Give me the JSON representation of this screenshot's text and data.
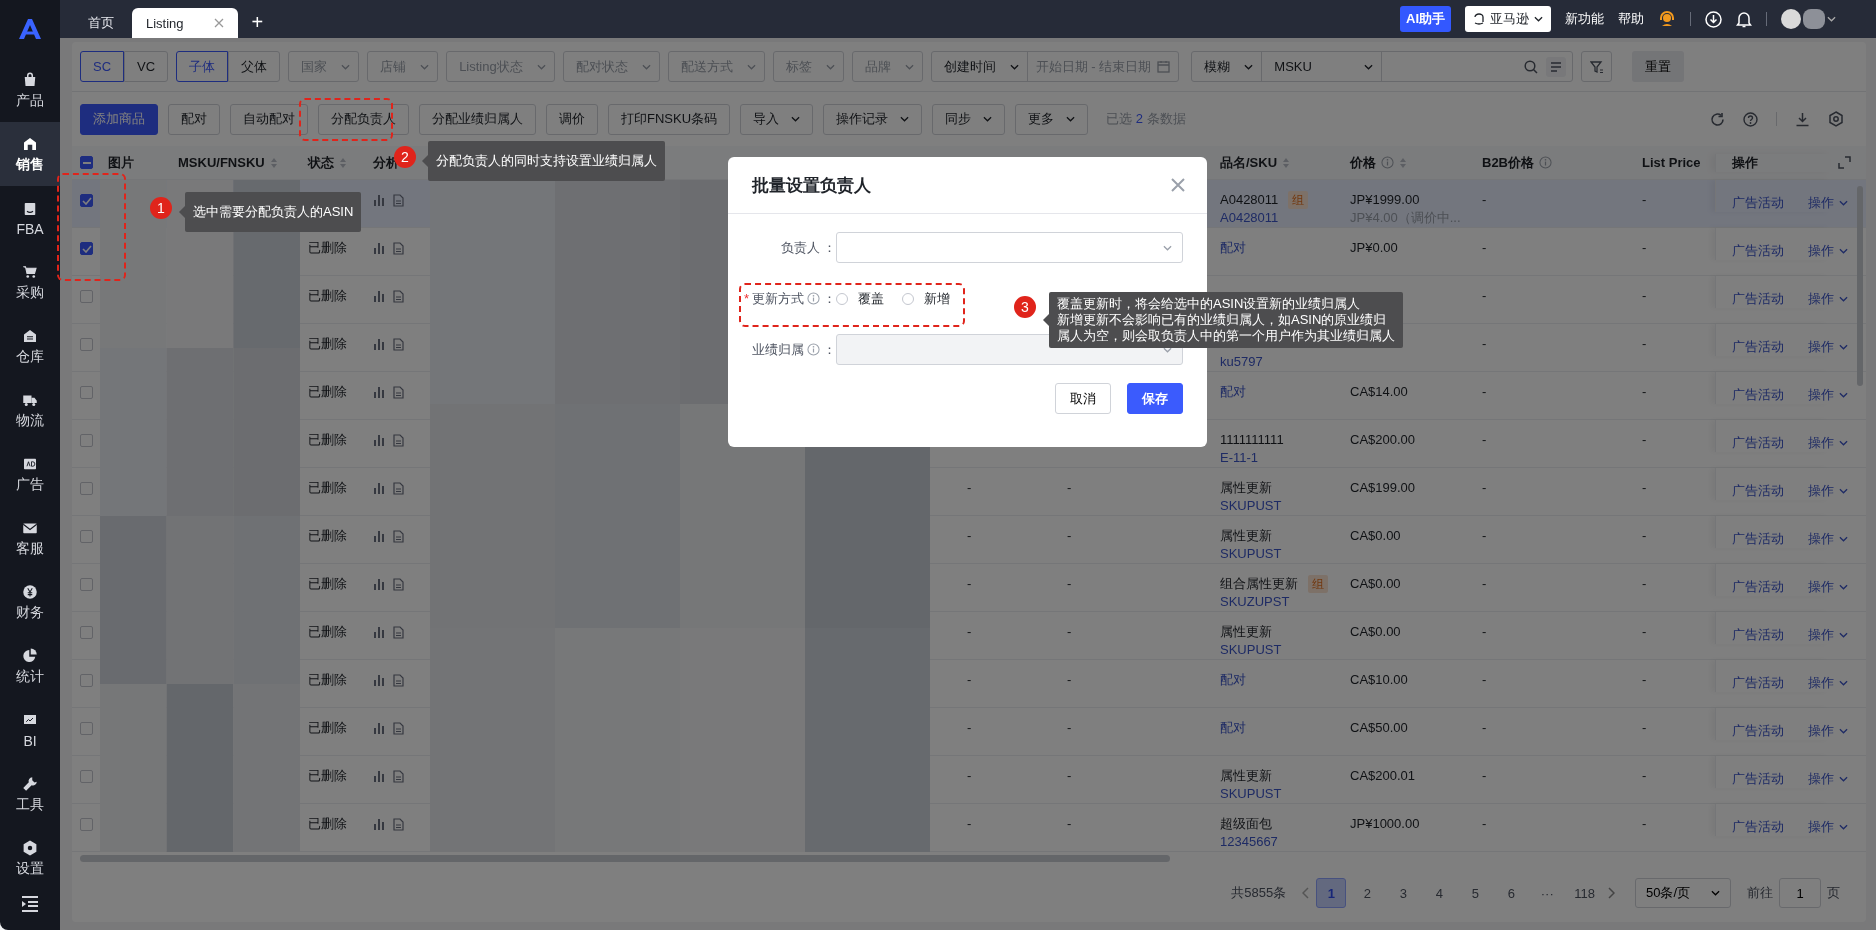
{
  "topbar": {
    "tabs": [
      {
        "label": "首页",
        "selected": false,
        "closable": false
      },
      {
        "label": "Listing",
        "selected": true,
        "closable": true
      }
    ],
    "add_tab": "+",
    "ai_button": "AI助手",
    "platform": "亚马逊",
    "links": [
      "新功能",
      "帮助"
    ]
  },
  "sidebar": {
    "items": [
      {
        "label": "产品",
        "selected": false
      },
      {
        "label": "销售",
        "selected": true
      },
      {
        "label": "FBA",
        "selected": false
      },
      {
        "label": "采购",
        "selected": false
      },
      {
        "label": "仓库",
        "selected": false
      },
      {
        "label": "物流",
        "selected": false
      },
      {
        "label": "广告",
        "selected": false
      },
      {
        "label": "客服",
        "selected": false
      },
      {
        "label": "财务",
        "selected": false
      },
      {
        "label": "统计",
        "selected": false
      },
      {
        "label": "BI",
        "selected": false
      },
      {
        "label": "工具",
        "selected": false
      },
      {
        "label": "设置",
        "selected": false
      }
    ]
  },
  "filters": {
    "segments": [
      [
        {
          "label": "SC",
          "selected": true
        },
        {
          "label": "VC",
          "selected": false
        }
      ],
      [
        {
          "label": "子体",
          "selected": true
        },
        {
          "label": "父体",
          "selected": false
        }
      ]
    ],
    "dropdowns": [
      "国家",
      "店铺",
      "Listing状态",
      "配对状态",
      "配送方式",
      "标签",
      "品牌"
    ],
    "date": {
      "field": "创建时间",
      "start_placeholder": "开始日期",
      "separator": "-",
      "end_placeholder": "结束日期"
    },
    "search": {
      "mode": "模糊",
      "field": "MSKU"
    },
    "reset": "重置"
  },
  "actions": {
    "buttons": [
      {
        "label": "添加商品",
        "kind": "primary"
      },
      {
        "label": "配对",
        "kind": "plain"
      },
      {
        "label": "自动配对",
        "kind": "plain"
      },
      {
        "label": "分配负责人",
        "kind": "plain"
      },
      {
        "label": "分配业绩归属人",
        "kind": "plain"
      },
      {
        "label": "调价",
        "kind": "plain"
      },
      {
        "label": "打印FNSKU条码",
        "kind": "plain"
      },
      {
        "label": "导入",
        "kind": "dropdown"
      },
      {
        "label": "操作记录",
        "kind": "dropdown"
      },
      {
        "label": "同步",
        "kind": "dropdown"
      },
      {
        "label": "更多",
        "kind": "dropdown"
      }
    ],
    "selection": {
      "prefix": "已选",
      "count": "2",
      "suffix": "条数据"
    }
  },
  "table": {
    "header_checkbox": {
      "indeterminate": true
    },
    "columns": [
      {
        "label": "图片",
        "sortable": false,
        "info": false
      },
      {
        "label": "MSKU/FNSKU",
        "sortable": true,
        "info": false
      },
      {
        "label": "状态",
        "sortable": true,
        "info": false
      },
      {
        "label": "分析"
      },
      {
        "label": "品名/SKU",
        "sortable": true,
        "info": false
      },
      {
        "label": "价格",
        "sortable": true,
        "info": true
      },
      {
        "label": "B2B价格",
        "sortable": false,
        "info": true
      },
      {
        "label": "List Price",
        "sortable": false,
        "info": false
      },
      {
        "label": "操作",
        "sortable": false,
        "info": false
      }
    ],
    "rows": [
      {
        "checked": true,
        "highlighted": true,
        "name": "A0428011",
        "name_tag": "组",
        "sku": "A0428011",
        "price": "JP¥1999.00",
        "price_note": "JP¥4.00（调价中...",
        "b2b": "-",
        "list_price": "-",
        "ad_link": "广告活动",
        "menu": "操作"
      },
      {
        "checked": true,
        "highlighted": false,
        "status": "已删除",
        "link": "配对",
        "price": "JP¥0.00",
        "b2b": "-",
        "list_price": "-",
        "ad_link": "广告活动",
        "menu": "操作"
      },
      {
        "checked": false,
        "highlighted": false,
        "status": "已删除",
        "b2b": "-",
        "list_price": "-",
        "ad_link": "广告活动",
        "menu": "操作"
      },
      {
        "checked": false,
        "highlighted": false,
        "status": "已删除",
        "sku": "ku5797",
        "b2b": "-",
        "list_price": "-",
        "ad_link": "广告活动",
        "menu": "操作"
      },
      {
        "checked": false,
        "highlighted": false,
        "status": "已删除",
        "link": "配对",
        "price": "CA$14.00",
        "b2b": "-",
        "list_price": "-",
        "ad_link": "广告活动",
        "menu": "操作"
      },
      {
        "checked": false,
        "highlighted": false,
        "status": "已删除",
        "name": "1111111111",
        "sku": "E-11-1",
        "price": "CA$200.00",
        "b2b": "-",
        "list_price": "-",
        "ad_link": "广告活动",
        "menu": "操作"
      },
      {
        "checked": false,
        "highlighted": false,
        "status": "已删除",
        "column_6": "-",
        "column_7": "-",
        "name": "属性更新",
        "sku": "SKUPUST",
        "price": "CA$199.00",
        "b2b": "-",
        "list_price": "-",
        "ad_link": "广告活动",
        "menu": "操作"
      },
      {
        "checked": false,
        "highlighted": false,
        "status": "已删除",
        "column_6": "-",
        "column_7": "-",
        "name": "属性更新",
        "sku": "SKUPUST",
        "price": "CA$0.00",
        "b2b": "-",
        "list_price": "-",
        "ad_link": "广告活动",
        "menu": "操作"
      },
      {
        "checked": false,
        "highlighted": false,
        "status": "已删除",
        "column_6": "-",
        "column_7": "-",
        "name": "组合属性更新",
        "name_tag": "组",
        "sku": "SKUZUPST",
        "price": "CA$0.00",
        "b2b": "-",
        "list_price": "-",
        "ad_link": "广告活动",
        "menu": "操作"
      },
      {
        "checked": false,
        "highlighted": false,
        "status": "已删除",
        "column_6": "-",
        "column_7": "-",
        "name": "属性更新",
        "sku": "SKUPUST",
        "price": "CA$0.00",
        "b2b": "-",
        "list_price": "-",
        "ad_link": "广告活动",
        "menu": "操作"
      },
      {
        "checked": false,
        "highlighted": false,
        "status": "已删除",
        "column_6": "-",
        "column_7": "-",
        "link": "配对",
        "price": "CA$10.00",
        "b2b": "-",
        "list_price": "-",
        "ad_link": "广告活动",
        "menu": "操作"
      },
      {
        "checked": false,
        "highlighted": false,
        "status": "已删除",
        "column_6": "-",
        "column_7": "-",
        "link": "配对",
        "price": "CA$50.00",
        "b2b": "-",
        "list_price": "-",
        "ad_link": "广告活动",
        "menu": "操作"
      },
      {
        "checked": false,
        "highlighted": false,
        "status": "已删除",
        "column_6": "-",
        "column_7": "-",
        "name": "属性更新",
        "sku": "SKUPUST",
        "price": "CA$200.01",
        "b2b": "-",
        "list_price": "-",
        "ad_link": "广告活动",
        "menu": "操作"
      },
      {
        "checked": false,
        "highlighted": false,
        "status": "已删除",
        "column_6": "-",
        "column_7": "-",
        "name": "超级面包",
        "sku": "12345667",
        "price": "JP¥1000.00",
        "b2b": "-",
        "list_price": "-",
        "ad_link": "广告活动",
        "menu": "操作"
      }
    ]
  },
  "pagination": {
    "total": "共5855条",
    "pages": [
      {
        "label": "1",
        "kind": "page",
        "selected": true
      },
      {
        "label": "2",
        "kind": "page",
        "selected": false
      },
      {
        "label": "3",
        "kind": "page",
        "selected": false
      },
      {
        "label": "4",
        "kind": "page",
        "selected": false
      },
      {
        "label": "5",
        "kind": "page",
        "selected": false
      },
      {
        "label": "6",
        "kind": "page",
        "selected": false
      },
      {
        "label": "···",
        "kind": "more"
      },
      {
        "label": "118",
        "kind": "page",
        "selected": false
      }
    ],
    "page_size": "50条/页",
    "goto_label": "前往",
    "goto_value": "1",
    "goto_suffix": "页"
  },
  "dialog": {
    "title": "批量设置负责人",
    "fields": [
      {
        "label": "负责人",
        "suffix": "：",
        "kind": "select",
        "info": false,
        "disabled": false
      },
      {
        "label": "更新方式",
        "suffix": "：",
        "kind": "radio",
        "required_mark": "*",
        "info": true,
        "options": [
          {
            "label": "覆盖",
            "selected": false
          },
          {
            "label": "新增",
            "selected": false
          }
        ]
      },
      {
        "label": "业绩归属",
        "suffix": "：",
        "kind": "select",
        "info": true,
        "disabled": true
      }
    ],
    "buttons": [
      {
        "label": "取消",
        "kind": "plain"
      },
      {
        "label": "保存",
        "kind": "primary"
      }
    ]
  },
  "annotations": [
    {
      "number": "1",
      "lines": [
        "选中需要分配负责人的ASIN"
      ]
    },
    {
      "number": "2",
      "lines": [
        "分配负责人的同时支持设置业绩归属人"
      ]
    },
    {
      "number": "3",
      "lines": [
        "覆盖更新时，将会给选中的ASIN设置新的业绩归属人",
        "新增更新不会影响已有的业绩归属人，如ASIN的原业绩归",
        "属人为空，则会取负责人中的第一个用户作为其业绩归属人"
      ]
    }
  ]
}
